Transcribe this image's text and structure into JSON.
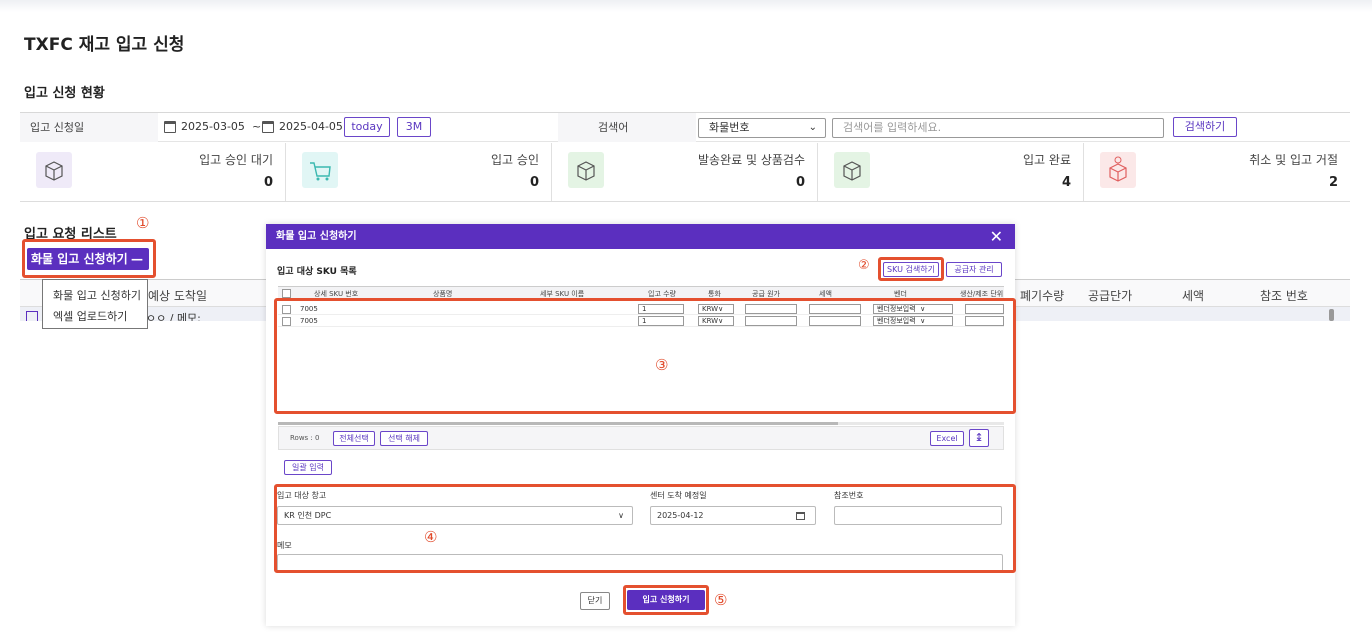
{
  "page": {
    "title": "TXFC 재고 입고 신청"
  },
  "status": {
    "section_title": "입고 신청 현황",
    "date_label": "입고 신청일",
    "date_from": "2025-03-05",
    "date_sep": "~",
    "date_to": "2025-04-05",
    "today_btn": "today",
    "range_btn": "3M",
    "search_label": "검색어",
    "search_field": "화물번호",
    "search_placeholder": "검색어를 입력하세요.",
    "search_btn": "검색하기",
    "cards": [
      {
        "label": "입고 승인 대기",
        "value": "0",
        "color": "#efeaf8",
        "icon": "box-icon"
      },
      {
        "label": "입고 승인",
        "value": "0",
        "color": "#e1f6f5",
        "icon": "cart-icon"
      },
      {
        "label": "발송완료 및 상품검수",
        "value": "0",
        "color": "#e4f4e4",
        "icon": "box-icon"
      },
      {
        "label": "입고 완료",
        "value": "4",
        "color": "#e4f4e4",
        "icon": "box-icon"
      },
      {
        "label": "취소 및 입고 거절",
        "value": "2",
        "color": "#fbe8e8",
        "icon": "cancel-box-icon"
      }
    ]
  },
  "requests": {
    "section_title": "입고 요청 리스트",
    "cargo_btn": "화물 입고 신청하기",
    "cargo_btn_icon": "—",
    "dropdown_items": [
      "화물 입고 신청하기",
      "엑셀 업로드하기"
    ],
    "col_arrival": "예상 도착일",
    "row_partial": "ㅇㅇ / 메모:",
    "cols_right": [
      "폐기수량",
      "공급단가",
      "세액",
      "참조 번호"
    ]
  },
  "annotations": [
    "①",
    "②",
    "③",
    "④",
    "⑤"
  ],
  "modal": {
    "title": "화물 입고 신청하기",
    "close_icon": "✕",
    "sku_section": "입고 대상 SKU 목록",
    "sku_search_btn": "SKU 검색하기",
    "supplier_btn": "공급자 관리",
    "grid_headers": [
      "상세 SKU 번호",
      "상품명",
      "세부 SKU 이름",
      "입고 수량",
      "통화",
      "공급 원가",
      "세액",
      "벤더",
      "생산/제조 단위"
    ],
    "rows": [
      {
        "sku": "7005",
        "qty": "1",
        "currency": "KRW",
        "vendor": "벤더정보입력"
      },
      {
        "sku": "7005",
        "qty": "1",
        "currency": "KRW",
        "vendor": "벤더정보입력"
      }
    ],
    "rows_count": "Rows : 0",
    "select_all_btn": "전체선택",
    "deselect_btn": "선택 해제",
    "excel_btn": "Excel",
    "bulk_btn": "일괄 입력",
    "warehouse_label": "입고 대상 창고",
    "warehouse_value": "KR 인천 DPC",
    "arrival_label": "센터 도착 예정일",
    "arrival_value": "2025-04-12",
    "ref_label": "참조번호",
    "memo_label": "메모",
    "close_btn": "닫기",
    "submit_btn": "입고 신청하기"
  },
  "colors": {
    "accent": "#5b2fbf",
    "highlight": "#e4502f"
  }
}
